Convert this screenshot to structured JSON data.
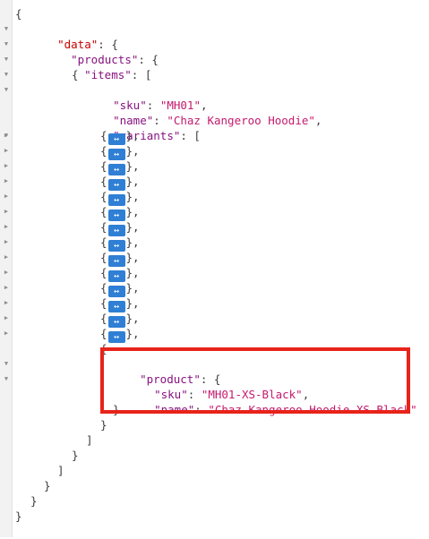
{
  "json_view": {
    "punct": {
      "open_brace": "{",
      "close_brace": "}",
      "open_bracket": "[",
      "close_bracket": "]",
      "colon_open_obj": ": {",
      "colon_open_arr": ": [",
      "colon": ": ",
      "comma": ",",
      "close_obj_comma": "},",
      "collapsed_open": "{",
      "collapsed_close": "},"
    },
    "keys": {
      "data": "\"data\"",
      "products": "\"products\"",
      "items": "\"items\"",
      "sku": "\"sku\"",
      "name": "\"name\"",
      "variants": "\"variants\"",
      "product": "\"product\""
    },
    "values": {
      "item_sku": "\"MH01\"",
      "item_name": "\"Chaz Kangeroo Hoodie\"",
      "variant_sku": "\"MH01-XS-Black\"",
      "variant_name": "\"Chaz Kangeroo Hoodie-XS-Black\""
    },
    "collapsed_icon": "↔",
    "toggle_expanded_icon": "triangle-down-icon",
    "toggle_collapsed_icon": "triangle-right-icon",
    "highlight_color": "#e8231a",
    "collapsed_variant_count": 14
  }
}
